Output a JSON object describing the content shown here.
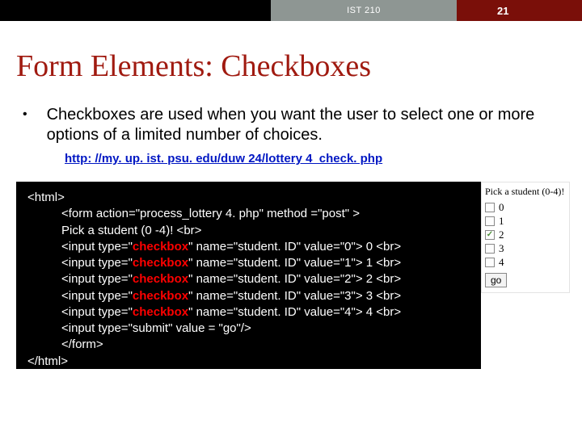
{
  "header": {
    "course": "IST 210",
    "page_num": "21"
  },
  "slide": {
    "title": "Form Elements: Checkboxes",
    "bullet": "Checkboxes are used when you want the user to select one or more options of a limited number of choices.",
    "link": "http: //my. up. ist. psu. edu/duw 24/lottery 4_check. php"
  },
  "code": {
    "l1": "<html>",
    "l2": "<form action=\"process_lottery 4. php\" method =\"post\" >",
    "l3": "Pick a student (0 -4)! <br>",
    "l4a": "<input type=\"",
    "hl": "checkbox",
    "l4_0b": "\" name=\"student. ID\" value=\"0\"> 0 <br>",
    "l4_1b": "\" name=\"student. ID\" value=\"1\"> 1 <br>",
    "l4_2b": "\" name=\"student. ID\" value=\"2\"> 2 <br>",
    "l4_3b": "\" name=\"student. ID\" value=\"3\"> 3 <br>",
    "l4_4b": "\" name=\"student. ID\" value=\"4\"> 4 <br>",
    "l5": "<input type=\"submit\" value = \"go\"/>",
    "l6": "</form>",
    "l7": "</html>"
  },
  "preview": {
    "title": "Pick a student (0-4)!",
    "opts": [
      "0",
      "1",
      "2",
      "3",
      "4"
    ],
    "checked_index": 2,
    "submit": "go"
  }
}
